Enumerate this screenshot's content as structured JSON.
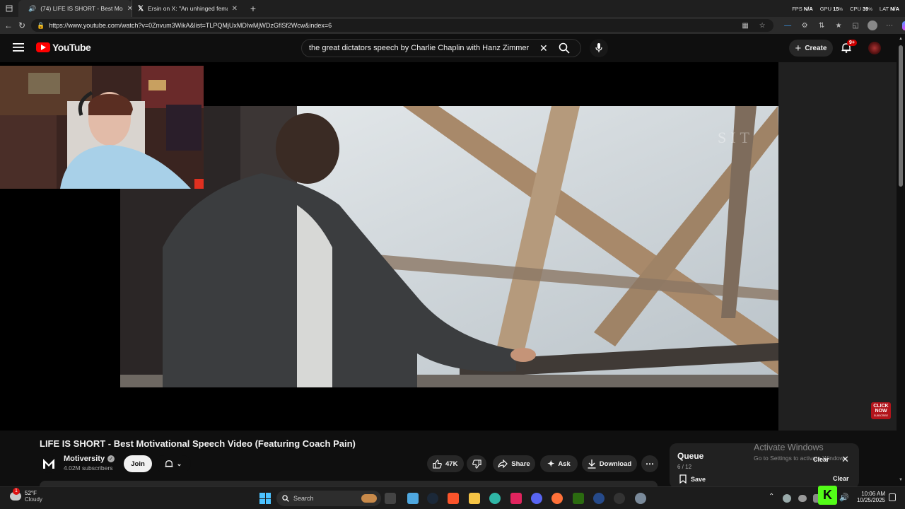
{
  "browser": {
    "tabs": [
      {
        "title": "(74) LIFE IS SHORT - Best Mo",
        "active": true
      },
      {
        "title": "Ersin on X: \"An unhinged female",
        "active": false
      }
    ],
    "new_tab": "+",
    "perf": {
      "fps_label": "FPS",
      "fps_value": "N/A",
      "gpu_label": "GPU",
      "gpu_value": "15",
      "cpu_label": "CPU",
      "cpu_value": "39",
      "lat_label": "LAT",
      "lat_value": "N/A"
    },
    "url": "https://www.youtube.com/watch?v=0Znvum3WikA&list=TLPQMjUxMDIwMjWDzGflSf2Wcw&index=6"
  },
  "youtube": {
    "logo_text": "YouTube",
    "search_query": "the great dictators speech by Charlie Chaplin with Hanz Zimmer",
    "create_label": "Create",
    "notif_badge": "9+"
  },
  "video": {
    "title": "LIFE IS SHORT - Best Motivational Speech Video (Featuring Coach Pain)",
    "watermark": "SIT",
    "click_now_line1": "CLICK",
    "click_now_line2": "NOW",
    "click_now_line3": "SUBSCRIBE"
  },
  "channel": {
    "name": "Motiversity",
    "subscribers": "4.02M subscribers",
    "join_label": "Join"
  },
  "actions": {
    "likes": "47K",
    "share": "Share",
    "ask": "Ask",
    "download": "Download"
  },
  "queue": {
    "title": "Queue",
    "position": "6 / 12",
    "clear_top": "Clear",
    "save": "Save",
    "clear_bottom": "Clear"
  },
  "activate": {
    "line1": "Activate Windows",
    "line2": "Go to Settings to activate Windows."
  },
  "taskbar": {
    "weather_temp": "52°F",
    "weather_desc": "Cloudy",
    "weather_badge": "1",
    "search_placeholder": "Search",
    "time": "10:06 AM",
    "date": "10/25/2025"
  },
  "colors": {
    "yt_red": "#ff0000",
    "accent_blue": "#3ea6ff"
  }
}
